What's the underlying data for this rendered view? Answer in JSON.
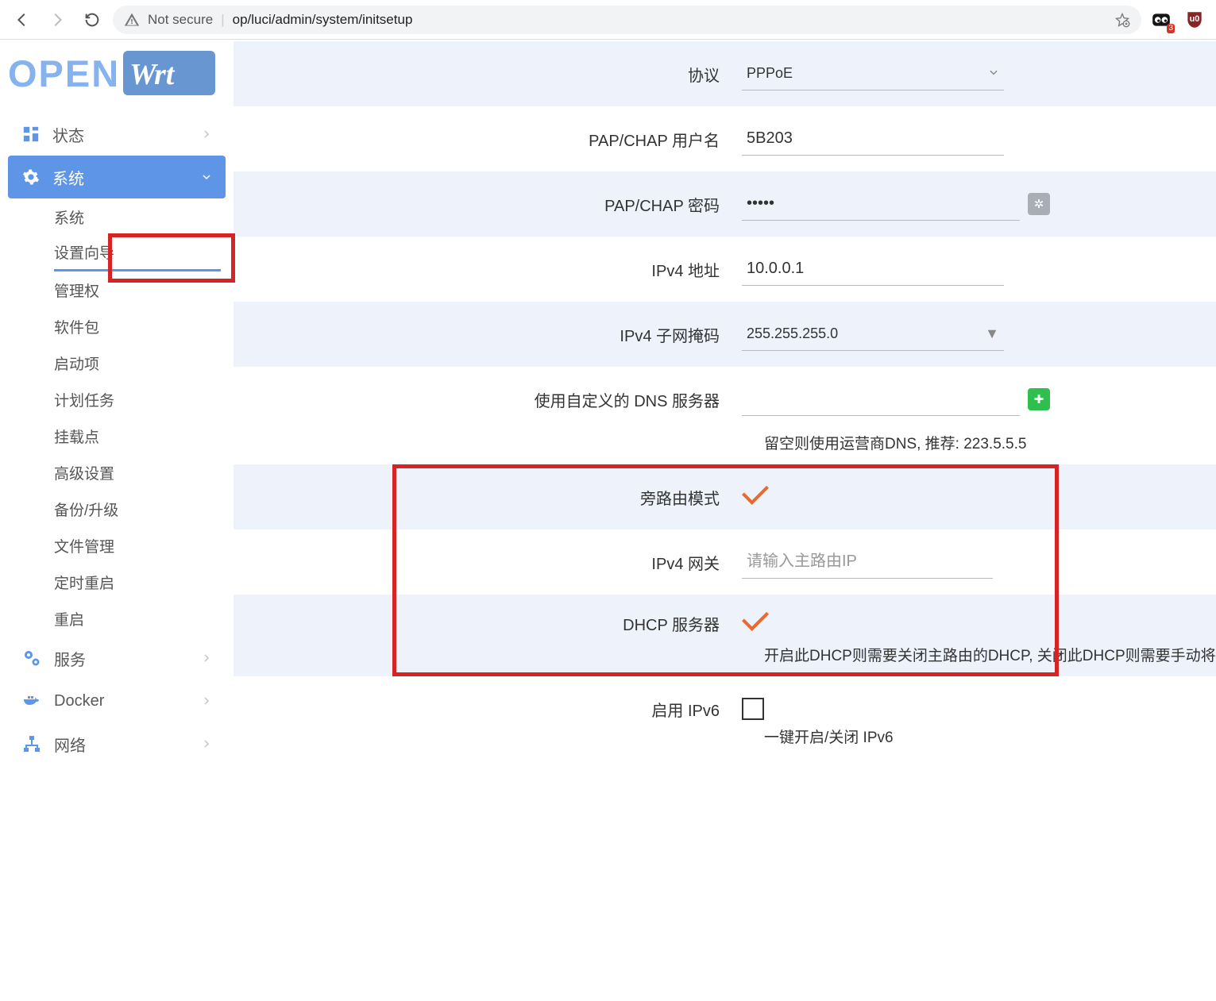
{
  "browser": {
    "secure_label": "Not secure",
    "url": "op/luci/admin/system/initsetup",
    "ext_badge": "3"
  },
  "logo": {
    "open": "OPEN",
    "wrt": "Wrt"
  },
  "nav": {
    "status": "状态",
    "system": "系统",
    "services": "服务",
    "docker": "Docker",
    "network": "网络"
  },
  "sub": {
    "system": "系统",
    "wizard": "设置向导",
    "admin": "管理权",
    "packages": "软件包",
    "startup": "启动项",
    "scheduled": "计划任务",
    "mounts": "挂载点",
    "advanced": "高级设置",
    "backup": "备份/升级",
    "files": "文件管理",
    "reboot_timer": "定时重启",
    "reboot": "重启"
  },
  "form": {
    "protocol_label": "协议",
    "protocol_value": "PPPoE",
    "username_label": "PAP/CHAP 用户名",
    "username_value": "5B203",
    "password_label": "PAP/CHAP 密码",
    "password_value": "•••••",
    "ipv4_label": "IPv4 地址",
    "ipv4_value": "10.0.0.1",
    "mask_label": "IPv4 子网掩码",
    "mask_value": "255.255.255.0",
    "dns_label": "使用自定义的 DNS 服务器",
    "dns_value": "",
    "dns_help": "留空则使用运营商DNS, 推荐: 223.5.5.5",
    "side_label": "旁路由模式",
    "gateway_label": "IPv4 网关",
    "gateway_placeholder": "请输入主路由IP",
    "dhcp_label": "DHCP 服务器",
    "dhcp_help": "开启此DHCP则需要关闭主路由的DHCP, 关闭此DHCP则需要手动将",
    "ipv6_enable_label": "启用 IPv6",
    "ipv6_help": "一键开启/关闭 IPv6"
  }
}
